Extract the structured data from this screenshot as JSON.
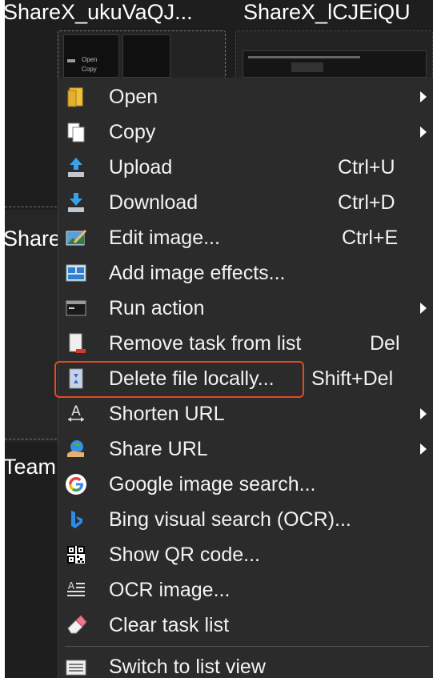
{
  "background": {
    "tabs": [
      "ShareX_ukuVaQJ...",
      "ShareX_lCJEiQU"
    ],
    "thumbnail_items": [
      "Open",
      "Copy"
    ],
    "partial_labels": [
      "Share",
      "Team"
    ]
  },
  "menu": {
    "items": [
      {
        "label": "Open",
        "shortcut": "",
        "submenu": true,
        "icon": "open-folder-icon"
      },
      {
        "label": "Copy",
        "shortcut": "",
        "submenu": true,
        "icon": "copy-icon"
      },
      {
        "label": "Upload",
        "shortcut": "Ctrl+U",
        "submenu": false,
        "icon": "upload-icon"
      },
      {
        "label": "Download",
        "shortcut": "Ctrl+D",
        "submenu": false,
        "icon": "download-icon"
      },
      {
        "label": "Edit image...",
        "shortcut": "Ctrl+E",
        "submenu": false,
        "icon": "edit-image-icon"
      },
      {
        "label": "Add image effects...",
        "shortcut": "",
        "submenu": false,
        "icon": "image-effects-icon"
      },
      {
        "label": "Run action",
        "shortcut": "",
        "submenu": true,
        "icon": "run-action-icon"
      },
      {
        "label": "Remove task from list",
        "shortcut": "Del",
        "submenu": false,
        "icon": "remove-task-icon"
      },
      {
        "label": "Delete file locally...",
        "shortcut": "Shift+Del",
        "submenu": false,
        "icon": "delete-file-icon"
      },
      {
        "label": "Shorten URL",
        "shortcut": "",
        "submenu": true,
        "icon": "shorten-url-icon"
      },
      {
        "label": "Share URL",
        "shortcut": "",
        "submenu": true,
        "icon": "share-url-icon"
      },
      {
        "label": "Google image search...",
        "shortcut": "",
        "submenu": false,
        "icon": "google-icon"
      },
      {
        "label": "Bing visual search (OCR)...",
        "shortcut": "",
        "submenu": false,
        "icon": "bing-icon"
      },
      {
        "label": "Show QR code...",
        "shortcut": "",
        "submenu": false,
        "icon": "qr-code-icon"
      },
      {
        "label": "OCR image...",
        "shortcut": "",
        "submenu": false,
        "icon": "ocr-icon"
      },
      {
        "label": "Clear task list",
        "shortcut": "",
        "submenu": false,
        "icon": "eraser-icon"
      },
      {
        "label": "Switch to list view",
        "shortcut": "",
        "submenu": false,
        "icon": "list-view-icon"
      }
    ],
    "highlighted_item": "Delete file locally..."
  },
  "colors": {
    "menu_bg": "#2b2b2b",
    "text": "#f2f2f2",
    "highlight_border": "#e04a22"
  }
}
